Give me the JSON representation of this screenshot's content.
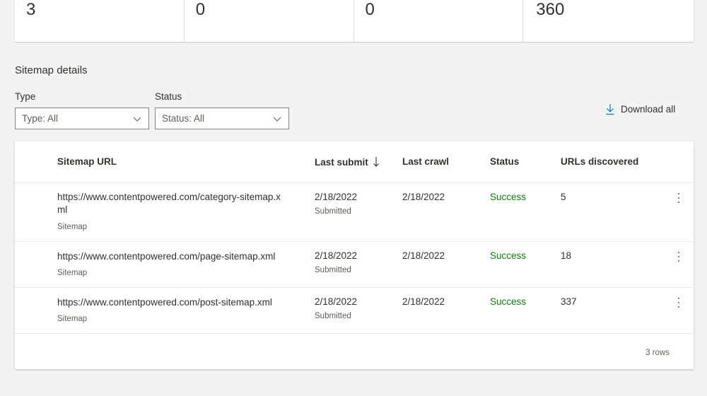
{
  "stats": [
    "3",
    "0",
    "0",
    "360"
  ],
  "section_title": "Sitemap details",
  "filters": {
    "type": {
      "label": "Type",
      "value": "Type: All"
    },
    "status": {
      "label": "Status",
      "value": "Status: All"
    }
  },
  "download_label": "Download all",
  "table": {
    "columns": {
      "url": "Sitemap URL",
      "last_submit": "Last submit",
      "last_crawl": "Last crawl",
      "status": "Status",
      "urls_discovered": "URLs discovered"
    },
    "rows": [
      {
        "url": "https://www.contentpowered.com/category-sitemap.x ml",
        "url_line1": "https://www.contentpowered.com/category-sitemap.x",
        "url_line2": "ml",
        "type": "Sitemap",
        "last_submit": "2/18/2022",
        "submit_note": "Submitted",
        "last_crawl": "2/18/2022",
        "status": "Success",
        "urls_discovered": "5"
      },
      {
        "url_line1": "https://www.contentpowered.com/page-sitemap.xml",
        "type": "Sitemap",
        "last_submit": "2/18/2022",
        "submit_note": "Submitted",
        "last_crawl": "2/18/2022",
        "status": "Success",
        "urls_discovered": "18"
      },
      {
        "url_line1": "https://www.contentpowered.com/post-sitemap.xml",
        "type": "Sitemap",
        "last_submit": "2/18/2022",
        "submit_note": "Submitted",
        "last_crawl": "2/18/2022",
        "status": "Success",
        "urls_discovered": "337"
      }
    ],
    "row_count": "3 rows"
  },
  "colors": {
    "success": "#107c10",
    "accent": "#0078d4"
  }
}
